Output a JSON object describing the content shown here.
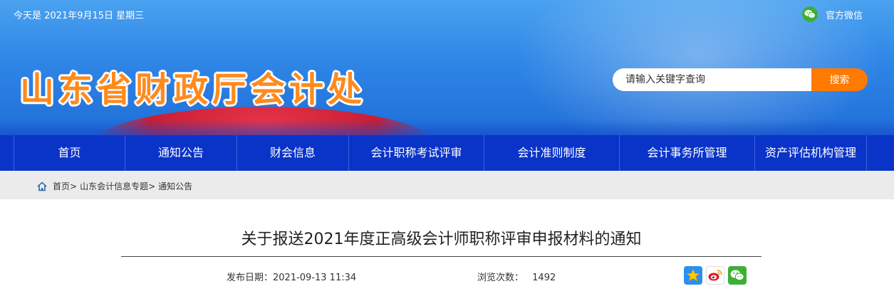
{
  "topbar": {
    "date_text": "今天是 2021年9月15日 星期三",
    "wechat_label": "官方微信"
  },
  "header": {
    "site_title": "山东省财政厅会计处",
    "search_placeholder": "请输入关键字查询",
    "search_button": "搜索"
  },
  "nav": {
    "items": [
      {
        "label": "首页"
      },
      {
        "label": "通知公告"
      },
      {
        "label": "财会信息"
      },
      {
        "label": "会计职称考试评审"
      },
      {
        "label": "会计准则制度"
      },
      {
        "label": "会计事务所管理"
      },
      {
        "label": "资产评估机构管理"
      }
    ]
  },
  "breadcrumb": {
    "items": [
      "首页>",
      "山东会计信息专题>",
      "通知公告"
    ]
  },
  "article": {
    "title": "关于报送2021年度正高级会计师职称评审申报材料的通知",
    "published": "发布日期：2021-09-13 11:34",
    "views_label": "浏览次数：",
    "views_value": "1492"
  },
  "share": {
    "icons": [
      "qzone-star-icon",
      "weibo-icon",
      "wechat-icon"
    ]
  },
  "colors": {
    "nav_bg": "#0a33c8",
    "accent_orange": "#ff7a00",
    "wechat_green": "#3cb034"
  }
}
